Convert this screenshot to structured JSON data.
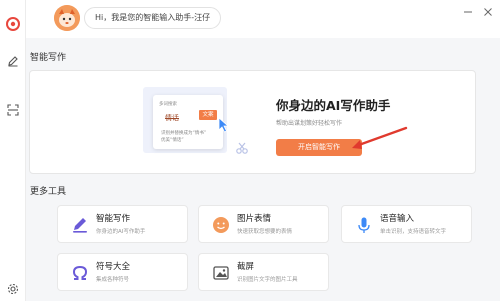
{
  "assistant": {
    "greeting": "Hi，我是您的智能输入助手-汪仔"
  },
  "sections": {
    "smart_writing": "智能写作",
    "more_tools": "更多工具"
  },
  "banner": {
    "title": "你身边的AI写作助手",
    "subtitle": "帮助出谋划策好轻松写作",
    "button_label": "开启智能写作",
    "card_tag": "多词搜索",
    "card_strike_word": "情话",
    "card_chip": "文案",
    "card_hint_1": "识别并替换成为“情书”",
    "card_hint_2": "优美“情话”"
  },
  "tools": [
    {
      "name": "智能写作",
      "desc": "你身边的AI写作助手",
      "icon": "pen-icon"
    },
    {
      "name": "图片表情",
      "desc": "快速获取您想要的表情",
      "icon": "emoji-icon"
    },
    {
      "name": "语音输入",
      "desc": "单击识别，支持语音转文字",
      "icon": "microphone-icon"
    },
    {
      "name": "符号大全",
      "desc": "集成各种符号",
      "icon": "omega-icon"
    },
    {
      "name": "截屏",
      "desc": "识别图片文字的图片工具",
      "icon": "screenshot-icon"
    }
  ],
  "colors": {
    "brand_red": "#e8473d",
    "accent_orange": "#f27d47",
    "mic_blue": "#3d8af7",
    "tool_purple": "#6a5ad8",
    "panel_bg": "#f5f6f8"
  }
}
